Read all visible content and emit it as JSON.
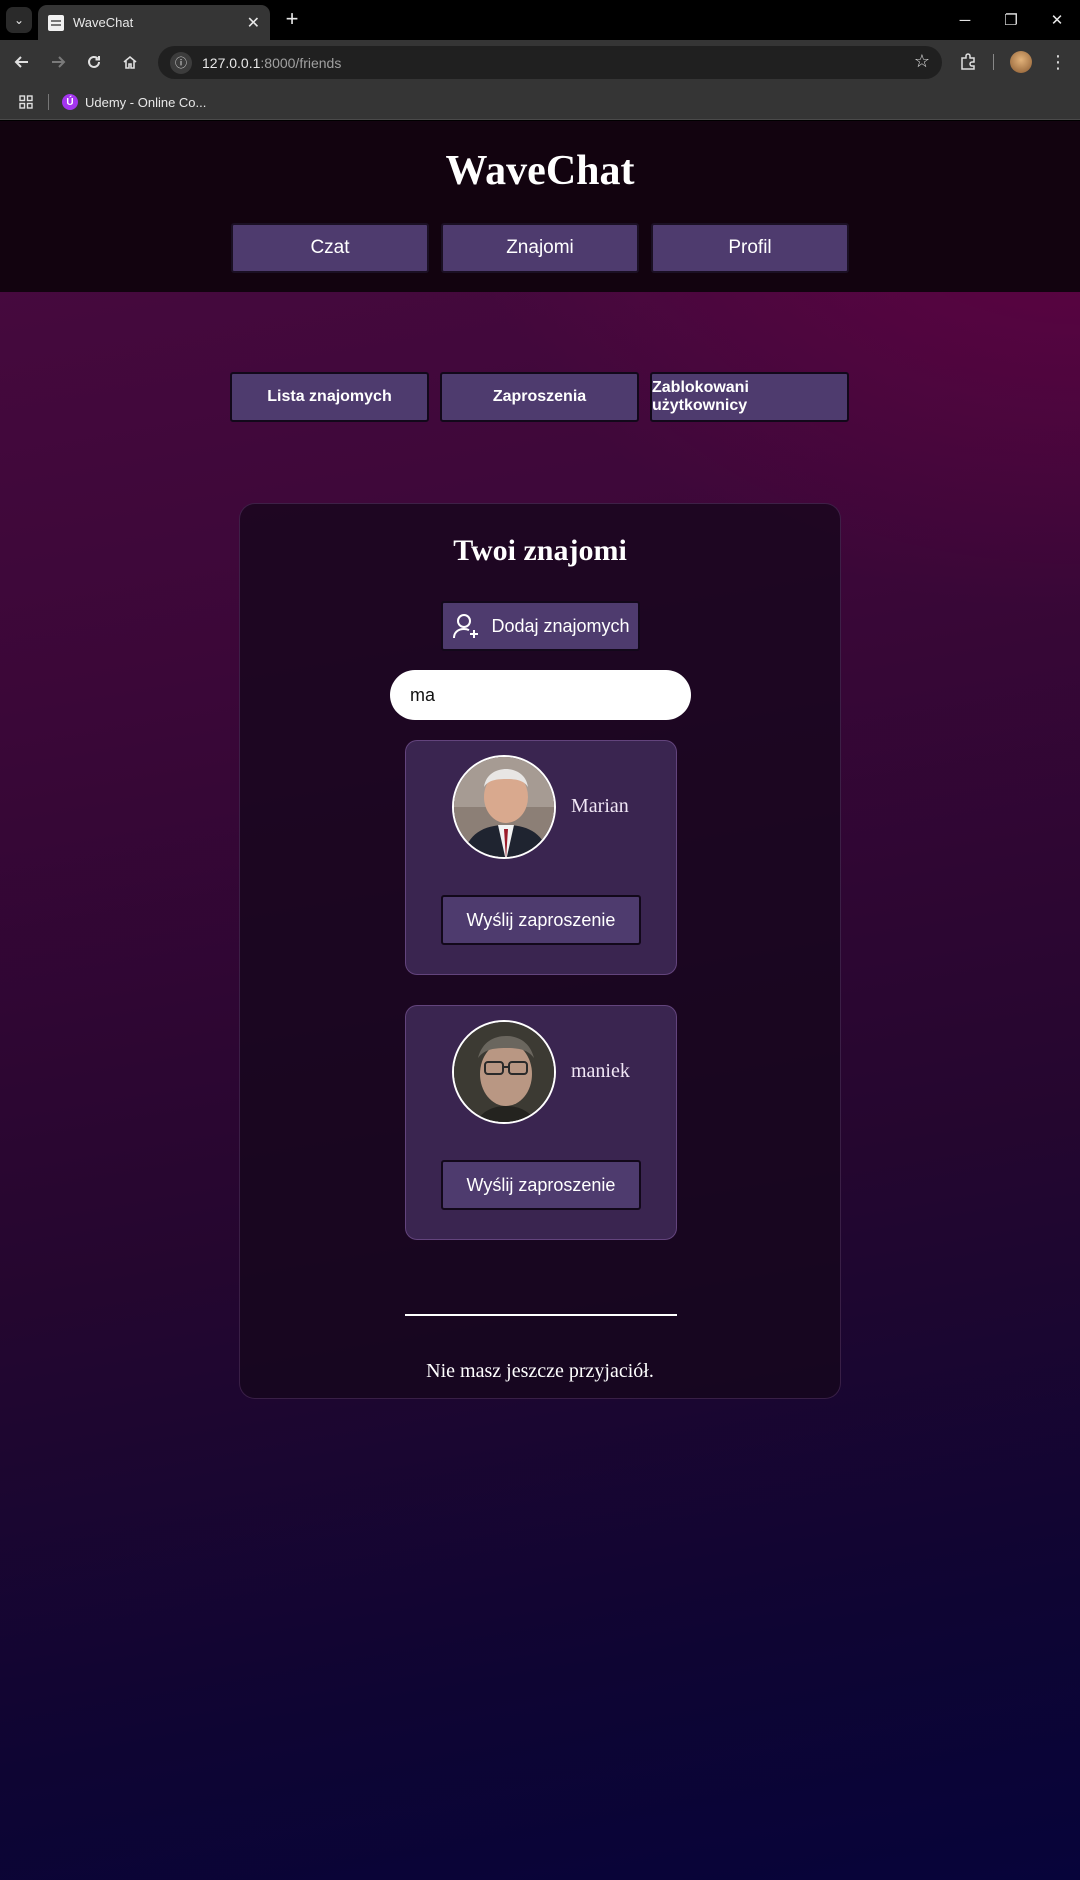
{
  "browser": {
    "tab_title": "WaveChat",
    "url_host": "127.0.0.1",
    "url_rest": ":8000/friends",
    "bookmark_label": "Udemy - Online Co...",
    "bookmark_icon": "Ú"
  },
  "header": {
    "title": "WaveChat",
    "nav": [
      {
        "label": "Czat"
      },
      {
        "label": "Znajomi"
      },
      {
        "label": "Profil"
      }
    ]
  },
  "subnav": [
    {
      "label": "Lista znajomych"
    },
    {
      "label": "Zaproszenia"
    },
    {
      "label": "Zablokowani użytkownicy"
    }
  ],
  "friends": {
    "title": "Twoi znajomi",
    "add_button_label": "Dodaj znajomych",
    "search_value": "ma",
    "results": [
      {
        "name": "Marian",
        "button_label": "Wyślij zaproszenie"
      },
      {
        "name": "maniek",
        "button_label": "Wyślij zaproszenie"
      }
    ],
    "empty_message": "Nie masz jeszcze przyjaciół."
  },
  "colors": {
    "button_bg": "#4e3b6e",
    "header_bg": "#12030f",
    "card_bg": "#3a2550"
  }
}
